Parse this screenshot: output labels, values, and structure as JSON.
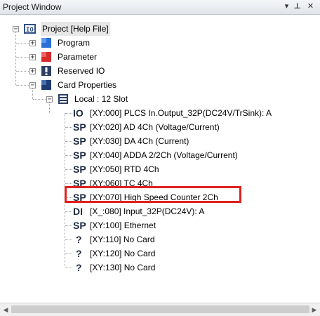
{
  "window": {
    "title": "Project Window"
  },
  "titlebar_buttons": {
    "pin": "▾",
    "autohide": "⊥",
    "close": "✕"
  },
  "tree": {
    "root": "Project [Help File]",
    "program": "Program",
    "parameter": "Parameter",
    "reserved_io": "Reserved IO",
    "card_properties": "Card Properties",
    "local": "Local : 12 Slot",
    "slots": [
      {
        "icon": "IO",
        "label": "[XY:000] PLCS In.Output_32P(DC24V/TrSink): A"
      },
      {
        "icon": "SP",
        "label": "[XY:020] AD 4Ch (Voltage/Current)"
      },
      {
        "icon": "SP",
        "label": "[XY:030] DA 4Ch (Current)"
      },
      {
        "icon": "SP",
        "label": "[XY:040] ADDA 2/2Ch (Voltage/Current)"
      },
      {
        "icon": "SP",
        "label": "[XY:050] RTD 4Ch"
      },
      {
        "icon": "SP",
        "label": "[XY:060] TC 4Ch"
      },
      {
        "icon": "SP",
        "label": "[XY:070] High Speed Counter 2Ch"
      },
      {
        "icon": "DI",
        "label": "[X_:080] Input_32P(DC24V): A"
      },
      {
        "icon": "SP",
        "label": "[XY:100] Ethernet"
      },
      {
        "icon": "?",
        "label": "[XY:110] No Card"
      },
      {
        "icon": "?",
        "label": "[XY:120] No Card"
      },
      {
        "icon": "?",
        "label": "[XY:130] No Card"
      }
    ]
  },
  "colors": {
    "highlight": "#e0201d",
    "program": "#2a6fd6",
    "parameter": "#d42a2a"
  }
}
